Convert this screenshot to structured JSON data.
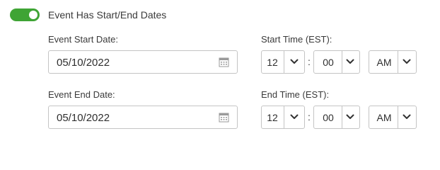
{
  "toggle": {
    "label": "Event Has Start/End Dates",
    "state": "on",
    "color": "#3fa435"
  },
  "start": {
    "date_label": "Event Start Date:",
    "date_value": "05/10/2022",
    "time_label": "Start Time (EST):",
    "hour": "12",
    "minute": "00",
    "ampm": "AM"
  },
  "end": {
    "date_label": "Event End Date:",
    "date_value": "05/10/2022",
    "time_label": "End Time (EST):",
    "hour": "12",
    "minute": "00",
    "ampm": "AM"
  },
  "separator": ":",
  "icons": {
    "calendar": "calendar-icon",
    "dropdown": "chevron-down-icon"
  }
}
